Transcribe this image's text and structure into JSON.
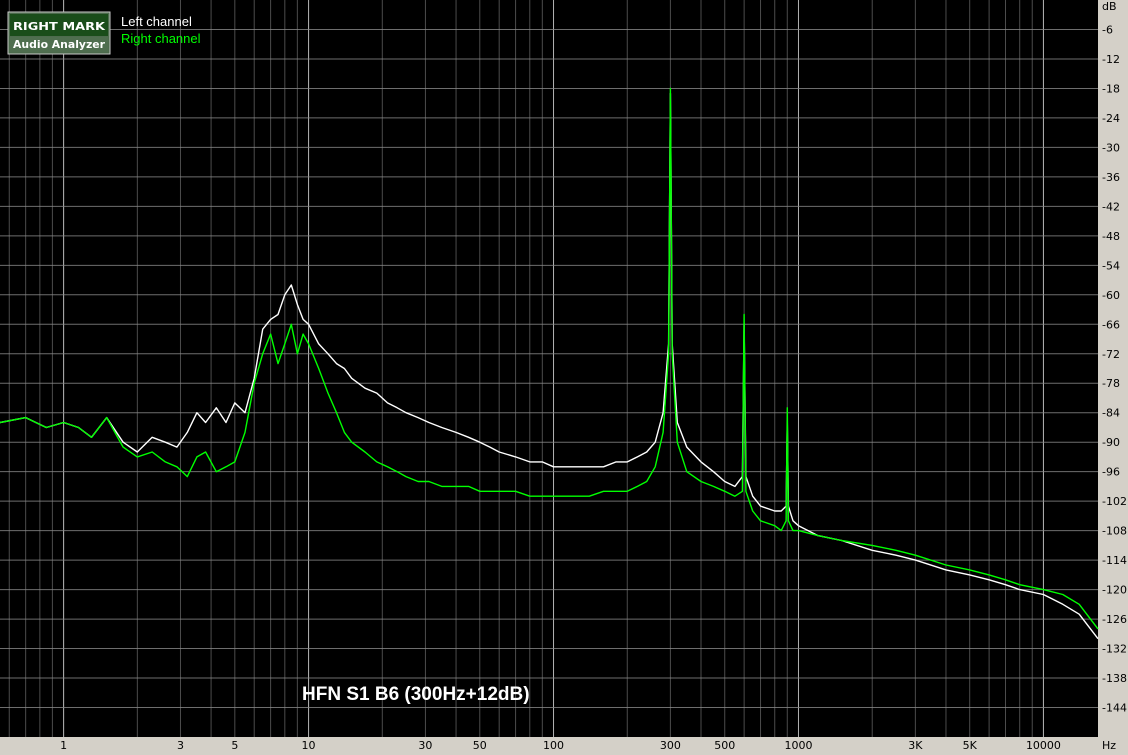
{
  "chart_data": {
    "type": "line",
    "title": "HFN S1 B6 (300Hz+12dB)",
    "xlabel": "Hz",
    "ylabel": "dB",
    "xscale": "log",
    "xlim": [
      0.55,
      16700
    ],
    "ylim": [
      -150,
      0
    ],
    "grid": true,
    "legend": "top-left",
    "background_color": "#000000",
    "grid_color": "#8a8a8a",
    "logo": {
      "line1": "RIGHT MARK",
      "line2": "Audio Analyzer"
    },
    "x_ticks": [
      {
        "value": 1,
        "label": "1"
      },
      {
        "value": 3,
        "label": "3"
      },
      {
        "value": 5,
        "label": "5"
      },
      {
        "value": 10,
        "label": "10"
      },
      {
        "value": 30,
        "label": "30"
      },
      {
        "value": 50,
        "label": "50"
      },
      {
        "value": 100,
        "label": "100"
      },
      {
        "value": 300,
        "label": "300"
      },
      {
        "value": 500,
        "label": "500"
      },
      {
        "value": 1000,
        "label": "1000"
      },
      {
        "value": 3000,
        "label": "3K"
      },
      {
        "value": 5000,
        "label": "5K"
      },
      {
        "value": 10000,
        "label": "10000"
      }
    ],
    "y_ticks": [
      {
        "value": -6,
        "label": "-6"
      },
      {
        "value": -12,
        "label": "-12"
      },
      {
        "value": -18,
        "label": "-18"
      },
      {
        "value": -24,
        "label": "-24"
      },
      {
        "value": -30,
        "label": "-30"
      },
      {
        "value": -36,
        "label": "-36"
      },
      {
        "value": -42,
        "label": "-42"
      },
      {
        "value": -48,
        "label": "-48"
      },
      {
        "value": -54,
        "label": "-54"
      },
      {
        "value": -60,
        "label": "-60"
      },
      {
        "value": -66,
        "label": "-66"
      },
      {
        "value": -72,
        "label": "-72"
      },
      {
        "value": -78,
        "label": "-78"
      },
      {
        "value": -84,
        "label": "-84"
      },
      {
        "value": -90,
        "label": "-90"
      },
      {
        "value": -96,
        "label": "-96"
      },
      {
        "value": -102,
        "label": "-102"
      },
      {
        "value": -108,
        "label": "-108"
      },
      {
        "value": -114,
        "label": "-114"
      },
      {
        "value": -120,
        "label": "-120"
      },
      {
        "value": -126,
        "label": "-126"
      },
      {
        "value": -132,
        "label": "-132"
      },
      {
        "value": -138,
        "label": "-138"
      },
      {
        "value": -144,
        "label": "-144"
      }
    ],
    "series": [
      {
        "name": "Left channel",
        "color": "#ffffff",
        "x": [
          0.55,
          0.7,
          0.85,
          1.0,
          1.15,
          1.3,
          1.5,
          1.75,
          2.0,
          2.3,
          2.6,
          2.9,
          3.2,
          3.5,
          3.8,
          4.2,
          4.6,
          5.0,
          5.5,
          6.0,
          6.5,
          7.0,
          7.5,
          8.0,
          8.5,
          9.0,
          9.5,
          10,
          11,
          12,
          13,
          14,
          15,
          17,
          19,
          21,
          23,
          25,
          28,
          31,
          35,
          40,
          45,
          50,
          55,
          60,
          70,
          80,
          90,
          100,
          120,
          140,
          160,
          180,
          200,
          220,
          240,
          260,
          280,
          295,
          300,
          305,
          320,
          350,
          400,
          450,
          500,
          550,
          590,
          600,
          610,
          650,
          700,
          800,
          850,
          890,
          900,
          910,
          950,
          1000,
          1200,
          1500,
          2000,
          2500,
          3000,
          4000,
          5000,
          6000,
          7000,
          8000,
          10000,
          12000,
          14000,
          16700
        ],
        "y": [
          -86,
          -85,
          -87,
          -86,
          -87,
          -89,
          -85,
          -90,
          -92,
          -89,
          -90,
          -91,
          -88,
          -84,
          -86,
          -83,
          -86,
          -82,
          -84,
          -77,
          -67,
          -65,
          -64,
          -60,
          -58,
          -62,
          -65,
          -66,
          -70,
          -72,
          -74,
          -75,
          -77,
          -79,
          -80,
          -82,
          -83,
          -84,
          -85,
          -86,
          -87,
          -88,
          -89,
          -90,
          -91,
          -92,
          -93,
          -94,
          -94,
          -95,
          -95,
          -95,
          -95,
          -94,
          -94,
          -93,
          -92,
          -90,
          -84,
          -70,
          -19,
          -70,
          -86,
          -91,
          -94,
          -96,
          -98,
          -99,
          -97,
          -66,
          -97,
          -101,
          -103,
          -104,
          -104,
          -103,
          -86,
          -103,
          -106,
          -107,
          -109,
          -110,
          -112,
          -113,
          -114,
          -116,
          -117,
          -118,
          -119,
          -120,
          -121,
          -123,
          -125,
          -130
        ]
      },
      {
        "name": "Right channel",
        "color": "#00ff00",
        "x": [
          0.55,
          0.7,
          0.85,
          1.0,
          1.15,
          1.3,
          1.5,
          1.75,
          2.0,
          2.3,
          2.6,
          2.9,
          3.2,
          3.5,
          3.8,
          4.2,
          4.6,
          5.0,
          5.5,
          6.0,
          6.5,
          7.0,
          7.5,
          8.0,
          8.5,
          9.0,
          9.5,
          10,
          11,
          12,
          13,
          14,
          15,
          17,
          19,
          21,
          23,
          25,
          28,
          31,
          35,
          40,
          45,
          50,
          55,
          60,
          70,
          80,
          90,
          100,
          120,
          140,
          160,
          180,
          200,
          220,
          240,
          260,
          280,
          295,
          300,
          305,
          320,
          350,
          400,
          450,
          500,
          550,
          590,
          600,
          610,
          650,
          700,
          800,
          850,
          890,
          900,
          910,
          950,
          1000,
          1200,
          1500,
          2000,
          2500,
          3000,
          4000,
          5000,
          6000,
          7000,
          8000,
          10000,
          12000,
          14000,
          16700
        ],
        "y": [
          -86,
          -85,
          -87,
          -86,
          -87,
          -89,
          -85,
          -91,
          -93,
          -92,
          -94,
          -95,
          -97,
          -93,
          -92,
          -96,
          -95,
          -94,
          -88,
          -78,
          -72,
          -68,
          -74,
          -70,
          -66,
          -72,
          -68,
          -70,
          -75,
          -80,
          -84,
          -88,
          -90,
          -92,
          -94,
          -95,
          -96,
          -97,
          -98,
          -98,
          -99,
          -99,
          -99,
          -100,
          -100,
          -100,
          -100,
          -101,
          -101,
          -101,
          -101,
          -101,
          -100,
          -100,
          -100,
          -99,
          -98,
          -95,
          -88,
          -72,
          -18,
          -72,
          -90,
          -96,
          -98,
          -99,
          -100,
          -101,
          -100,
          -64,
          -100,
          -104,
          -106,
          -107,
          -108,
          -106,
          -83,
          -106,
          -108,
          -108,
          -109,
          -110,
          -111,
          -112,
          -113,
          -115,
          -116,
          -117,
          -118,
          -119,
          -120,
          -121,
          -123,
          -128
        ]
      }
    ]
  }
}
